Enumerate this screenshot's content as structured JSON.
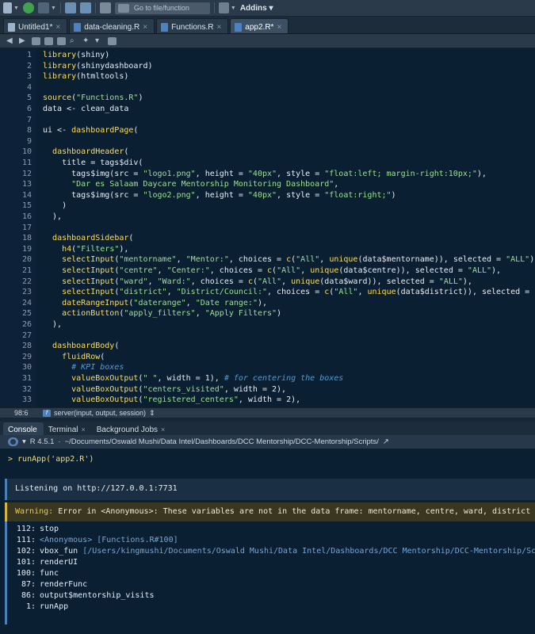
{
  "toolbar": {
    "goto_placeholder": "Go to file/function",
    "addins_label": "Addins"
  },
  "editor_tabs": [
    {
      "label": "Untitled1*",
      "active": false
    },
    {
      "label": "data-cleaning.R",
      "active": false
    },
    {
      "label": "Functions.R",
      "active": false
    },
    {
      "label": "app2.R*",
      "active": true
    }
  ],
  "code_lines": [
    {
      "n": "1",
      "text": "library(shiny)"
    },
    {
      "n": "2",
      "text": "library(shinydashboard)"
    },
    {
      "n": "3",
      "text": "library(htmltools)"
    },
    {
      "n": "4",
      "text": ""
    },
    {
      "n": "5",
      "text": "source(\"Functions.R\")"
    },
    {
      "n": "6",
      "text": "data <- clean_data"
    },
    {
      "n": "7",
      "text": ""
    },
    {
      "n": "8",
      "text": "ui <- dashboardPage("
    },
    {
      "n": "9",
      "text": ""
    },
    {
      "n": "10",
      "text": "  dashboardHeader("
    },
    {
      "n": "11",
      "text": "    title = tags$div("
    },
    {
      "n": "12",
      "text": "      tags$img(src = \"logo1.png\", height = \"40px\", style = \"float:left; margin-right:10px;\"),"
    },
    {
      "n": "13",
      "text": "      \"Dar es Salaam Daycare Mentorship Monitoring Dashboard\","
    },
    {
      "n": "14",
      "text": "      tags$img(src = \"logo2.png\", height = \"40px\", style = \"float:right;\")"
    },
    {
      "n": "15",
      "text": "    )"
    },
    {
      "n": "16",
      "text": "  ),"
    },
    {
      "n": "17",
      "text": ""
    },
    {
      "n": "18",
      "text": "  dashboardSidebar("
    },
    {
      "n": "19",
      "text": "    h4(\"Filters\"),"
    },
    {
      "n": "20",
      "text": "    selectInput(\"mentorname\", \"Mentor:\", choices = c(\"All\", unique(data$mentorname)), selected = \"ALL\"),"
    },
    {
      "n": "21",
      "text": "    selectInput(\"centre\", \"Center:\", choices = c(\"All\", unique(data$centre)), selected = \"ALL\"),"
    },
    {
      "n": "22",
      "text": "    selectInput(\"ward\", \"Ward:\", choices = c(\"All\", unique(data$ward)), selected = \"ALL\"),"
    },
    {
      "n": "23",
      "text": "    selectInput(\"district\", \"District/Council:\", choices = c(\"All\", unique(data$district)), selected = \"ALL\""
    },
    {
      "n": "24",
      "text": "    dateRangeInput(\"daterange\", \"Date range:\"),"
    },
    {
      "n": "25",
      "text": "    actionButton(\"apply_filters\", \"Apply Filters\")"
    },
    {
      "n": "26",
      "text": "  ),"
    },
    {
      "n": "27",
      "text": ""
    },
    {
      "n": "28",
      "text": "  dashboardBody("
    },
    {
      "n": "29",
      "text": "    fluidRow("
    },
    {
      "n": "30",
      "text": "      # KPI boxes"
    },
    {
      "n": "31",
      "text": "      valueBoxOutput(\" \", width = 1), # for centering the boxes"
    },
    {
      "n": "32",
      "text": "      valueBoxOutput(\"centers_visited\", width = 2),"
    },
    {
      "n": "33",
      "text": "      valueBoxOutput(\"registered_centers\", width = 2),"
    }
  ],
  "status_bar": {
    "cursor": "98:6",
    "scope": "server(input, output, session)"
  },
  "console_tabs": [
    {
      "label": "Console",
      "active": true
    },
    {
      "label": "Terminal",
      "active": false
    },
    {
      "label": "Background Jobs",
      "active": false
    }
  ],
  "console_path": {
    "r_version": "R 4.5.1",
    "path": "~/Documents/Oswald Mushi/Data Intel/Dashboards/DCC Mentorship/DCC-Mentorship/Scripts/"
  },
  "console": {
    "prompt": "> runApp('app2.R')",
    "listening": "Listening on http://127.0.0.1:7731",
    "warning_label": "Warning:",
    "warning_text": " Error in <Anonymous>: These variables are not in the data frame: mentorname, centre, ward, district",
    "traceback": [
      {
        "num": "112:",
        "fn": "stop",
        "src": ""
      },
      {
        "num": "111:",
        "fn": "<Anonymous>",
        "src": " [Functions.R#100]"
      },
      {
        "num": "102:",
        "fn": "vbox_fun",
        "src": " [/Users/kingmushi/Documents/Oswald Mushi/Data Intel/Dashboards/DCC Mentorship/DCC-Mentorship/Scripts"
      },
      {
        "num": "101:",
        "fn": "renderUI",
        "src": ""
      },
      {
        "num": "100:",
        "fn": "func",
        "src": ""
      },
      {
        "num": "87:",
        "fn": "renderFunc",
        "src": ""
      },
      {
        "num": "86:",
        "fn": "output$mentorship_visits",
        "src": ""
      },
      {
        "num": "1:",
        "fn": "runApp",
        "src": ""
      }
    ]
  }
}
